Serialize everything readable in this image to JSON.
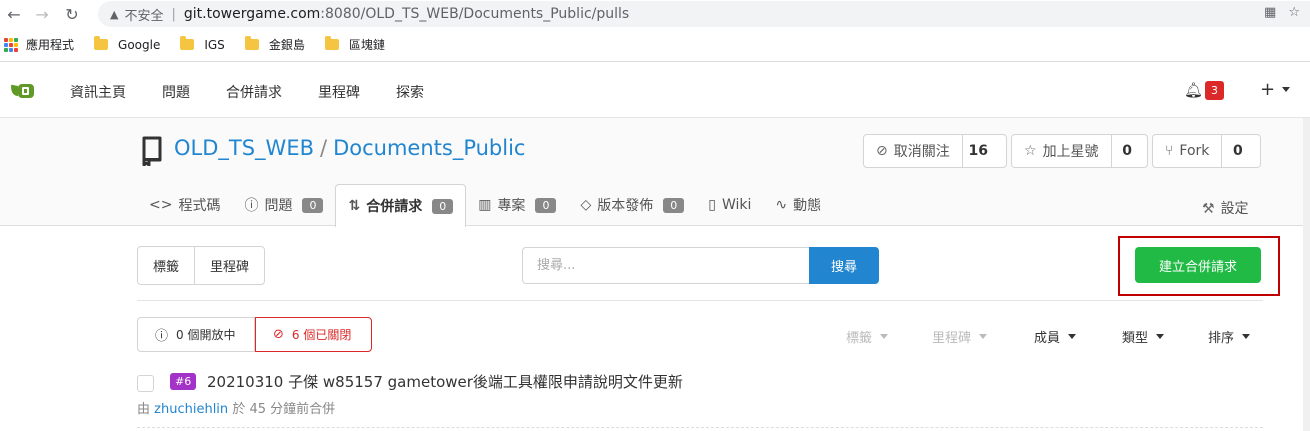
{
  "browser": {
    "insecure_label": "不安全",
    "url_host": "git.towergame.com",
    "url_path": ":8080/OLD_TS_WEB/Documents_Public/pulls",
    "bookmarks": [
      "應用程式",
      "Google",
      "IGS",
      "金銀島",
      "區塊鏈"
    ]
  },
  "nav": {
    "items": [
      "資訊主頁",
      "問題",
      "合併請求",
      "里程碑",
      "探索"
    ],
    "notification_count": "3",
    "plus": "+"
  },
  "repo": {
    "owner": "OLD_TS_WEB",
    "slash": "/",
    "name": "Documents_Public",
    "watch_label": "取消關注",
    "watch_count": "16",
    "star_label": "加上星號",
    "star_count": "0",
    "fork_label": "Fork",
    "fork_count": "0"
  },
  "tabs": [
    {
      "label": "程式碼",
      "icon": "<>"
    },
    {
      "label": "問題",
      "badge": "0"
    },
    {
      "label": "合併請求",
      "badge": "0"
    },
    {
      "label": "專案",
      "badge": "0"
    },
    {
      "label": "版本發佈",
      "badge": "0"
    },
    {
      "label": "Wiki"
    },
    {
      "label": "動態"
    }
  ],
  "settings_label": "設定",
  "filter": {
    "labels_btn": "標籤",
    "milestones_btn": "里程碑",
    "search_placeholder": "搜尋...",
    "search_btn": "搜尋",
    "new_pr_btn": "建立合併請求",
    "open_label": "0 個開放中",
    "closed_label": "6 個已關閉",
    "dd_label": "標籤",
    "dd_milestone": "里程碑",
    "dd_author": "成員",
    "dd_type": "類型",
    "dd_sort": "排序"
  },
  "pulls": [
    {
      "number": "#6",
      "title": "20210310 子傑 w85157 gametower後端工具權限申請說明文件更新",
      "by": "由",
      "user": "zhuchiehlin",
      "time": "於 45 分鐘前合併"
    }
  ],
  "colors": {
    "primary": "#2185d0",
    "green": "#21ba45",
    "red": "#db2828",
    "purple": "#a333c8"
  }
}
